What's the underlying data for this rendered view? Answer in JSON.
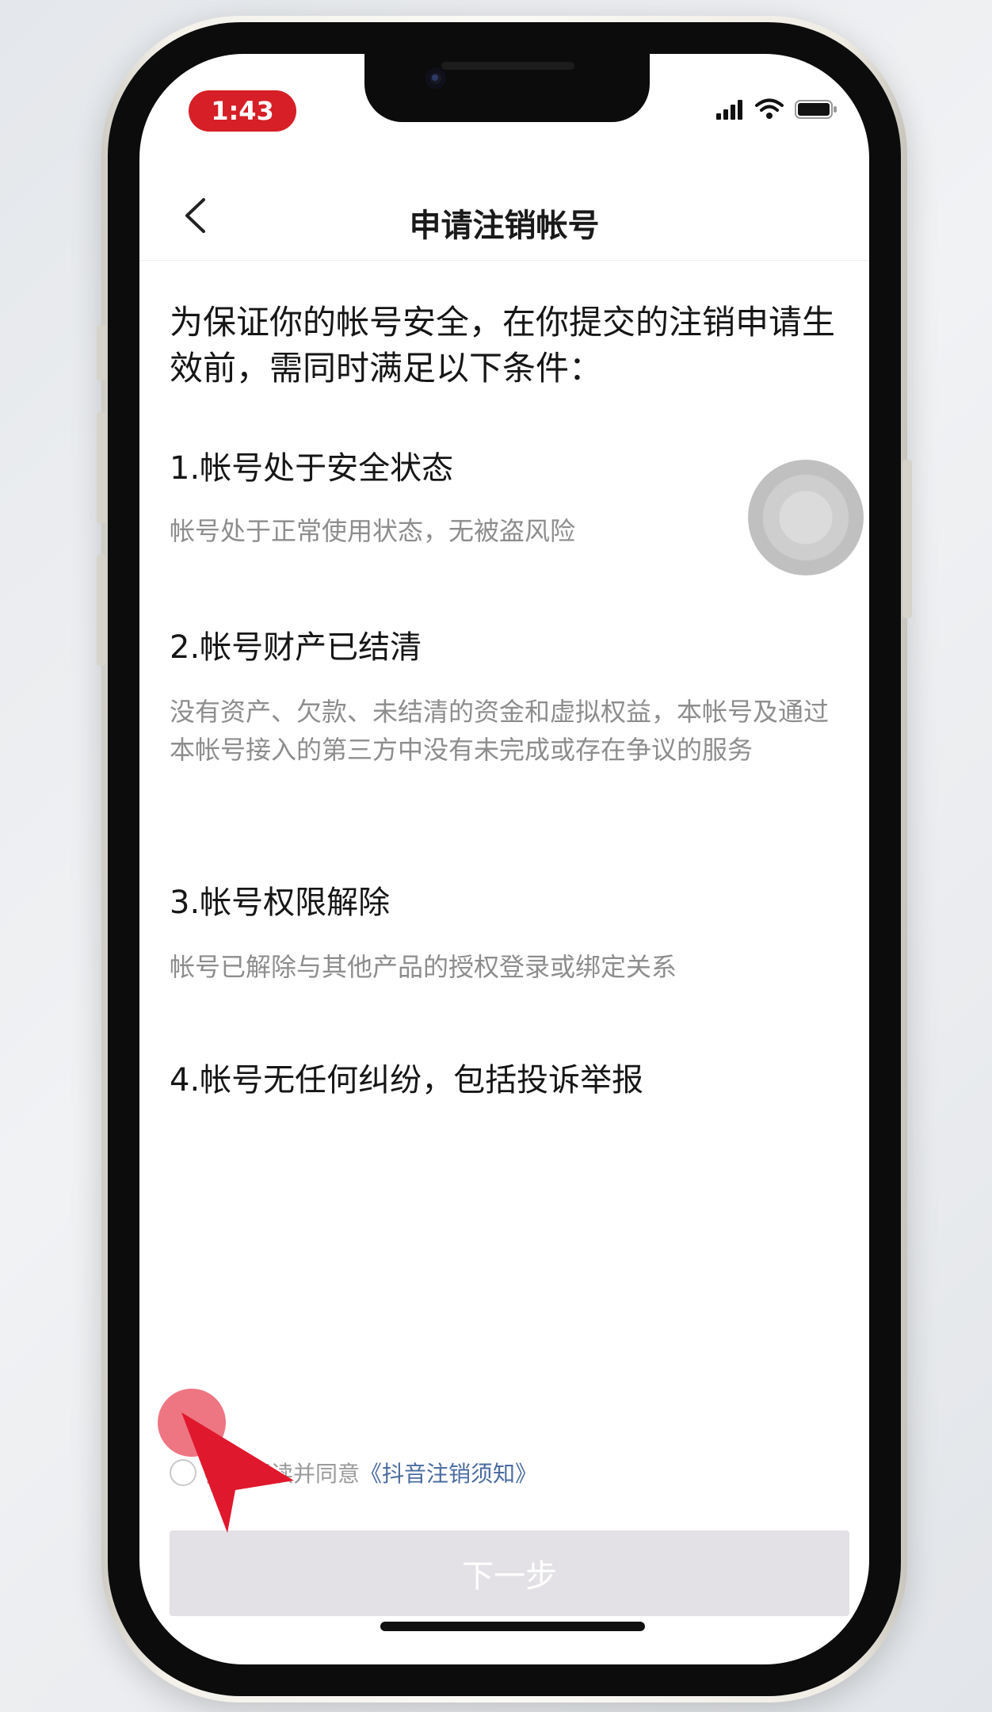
{
  "status_bar": {
    "time": "1:43"
  },
  "nav": {
    "title": "申请注销帐号"
  },
  "intro_text": "为保证你的帐号安全，在你提交的注销申请生效前，需同时满足以下条件：",
  "conditions": [
    {
      "title": "1.帐号处于安全状态",
      "desc": "帐号处于正常使用状态，无被盗风险"
    },
    {
      "title": "2.帐号财产已结清",
      "desc": "没有资产、欠款、未结清的资金和虚拟权益，本帐号及通过本帐号接入的第三方中没有未完成或存在争议的服务"
    },
    {
      "title": "3.帐号权限解除",
      "desc": "帐号已解除与其他产品的授权登录或绑定关系"
    },
    {
      "title": "4.帐号无任何纠纷，包括投诉举报"
    }
  ],
  "agreement": {
    "text": "我已阅读并同意",
    "link": "《抖音注销须知》"
  },
  "next_button": {
    "label": "下一步"
  },
  "colors": {
    "time_pill": "#d61f26",
    "link": "#4a6ba0",
    "button_disabled": "#e3e1e5",
    "cursor": "#e0182d"
  }
}
